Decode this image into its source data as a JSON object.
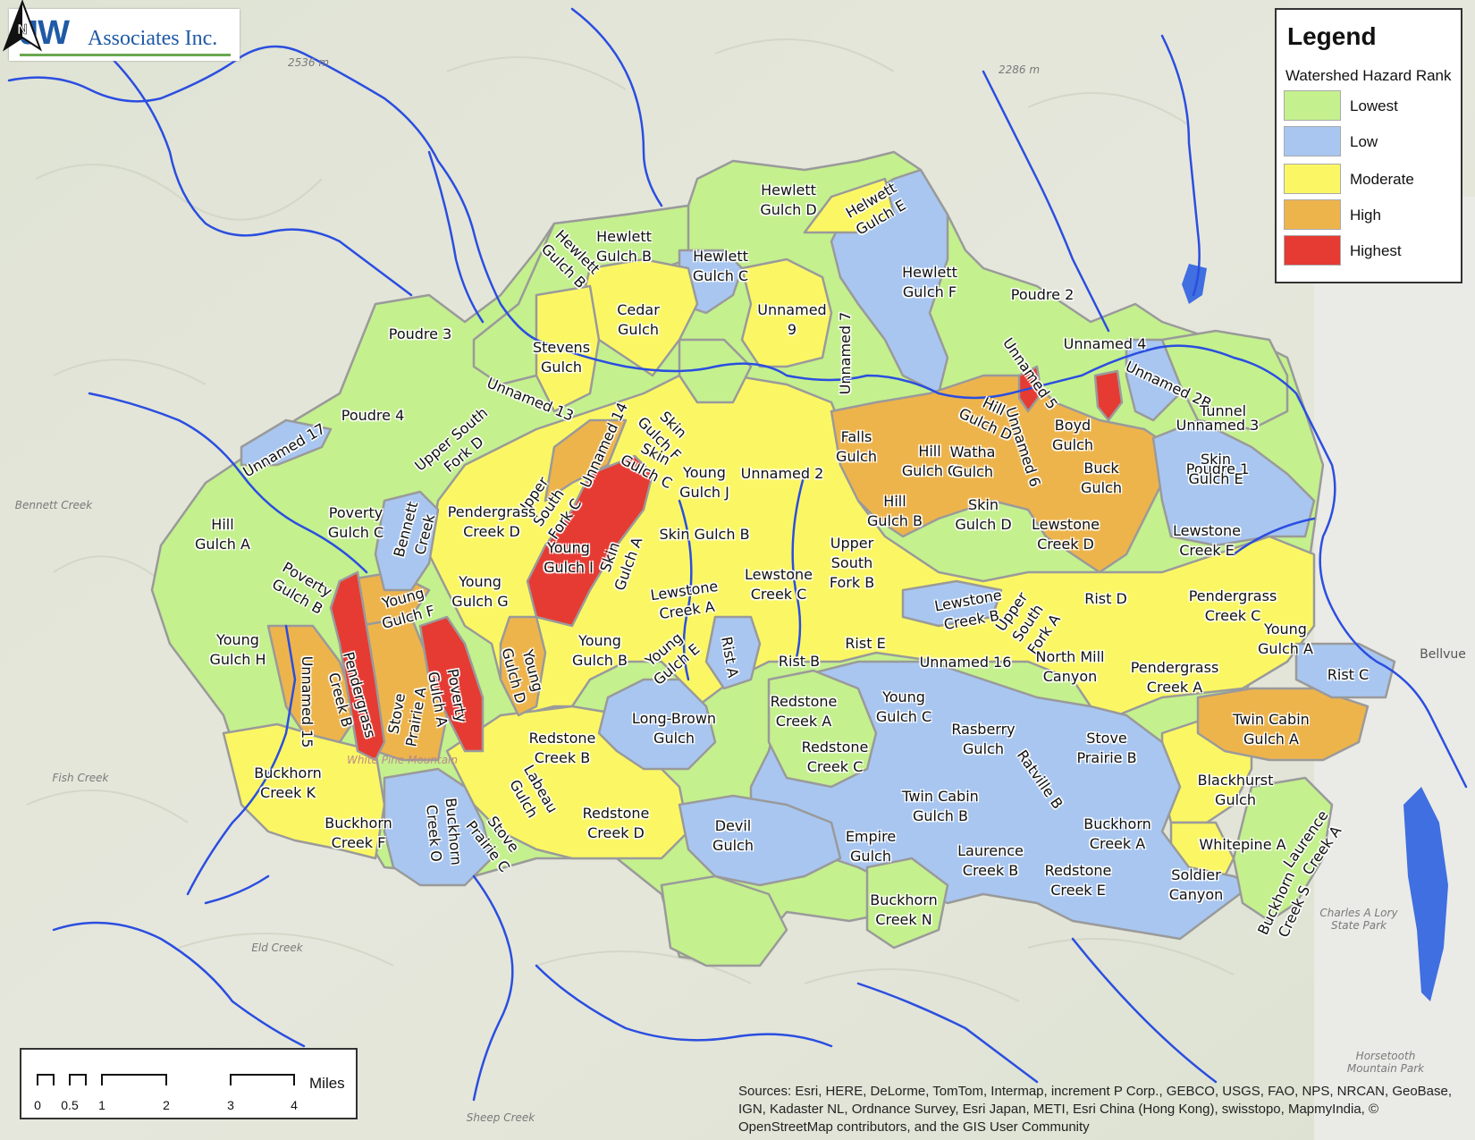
{
  "logo": {
    "brand": "JW",
    "company": "Associates Inc."
  },
  "legend": {
    "title": "Legend",
    "subtitle": "Watershed Hazard Rank",
    "classes": [
      {
        "label": "Lowest",
        "color": "#c4f08e"
      },
      {
        "label": "Low",
        "color": "#a8c6f0"
      },
      {
        "label": "Moderate",
        "color": "#fbf764"
      },
      {
        "label": "High",
        "color": "#eeb44c"
      },
      {
        "label": "Highest",
        "color": "#e53b33"
      }
    ]
  },
  "north_arrow": {
    "label": "N"
  },
  "scalebar": {
    "unit": "Miles",
    "ticks": [
      "0",
      "0.5",
      "1",
      "2",
      "3",
      "4"
    ]
  },
  "credits": "Sources: Esri, HERE, DeLorme, TomTom, Intermap, increment P Corp., GEBCO, USGS, FAO, NPS, NRCAN, GeoBase, IGN, Kadaster NL, Ordnance Survey, Esri Japan, METI, Esri China (Hong Kong), swisstopo, MapmyIndia, © OpenStreetMap contributors, and the GIS User Community",
  "basemap_labels": [
    "2536 m",
    "2286 m",
    "Bellvue",
    "Charles A Lory State Park",
    "Horsetooth Mountain Park",
    "White Pine Mountain",
    "Sheep Creek",
    "Eld Creek",
    "Fish Creek",
    "Bennett Creek"
  ],
  "watersheds": [
    {
      "name": "Hewlett\nGulch D",
      "rank": "Lowest"
    },
    {
      "name": "Helwett\nGulch E",
      "rank": "Moderate"
    },
    {
      "name": "Hewlett\nGulch B",
      "rank": "Lowest"
    },
    {
      "name": "Hewlett\nGulch B",
      "rank": "Lowest"
    },
    {
      "name": "Hewlett\nGulch C",
      "rank": "Low"
    },
    {
      "name": "Hewlett\nGulch F",
      "rank": "Low"
    },
    {
      "name": "Cedar\nGulch",
      "rank": "Moderate"
    },
    {
      "name": "Unnamed\n9",
      "rank": "Moderate"
    },
    {
      "name": "Poudre 2",
      "rank": "Lowest"
    },
    {
      "name": "Poudre 3",
      "rank": "Lowest"
    },
    {
      "name": "Stevens\nGulch",
      "rank": "Moderate"
    },
    {
      "name": "Unnamed 7",
      "rank": "Moderate"
    },
    {
      "name": "Unnamed 4",
      "rank": "Lowest"
    },
    {
      "name": "Unnamed 13",
      "rank": "Lowest"
    },
    {
      "name": "Unnamed 5",
      "rank": "Highest"
    },
    {
      "name": "Unnamed 2B",
      "rank": "Highest"
    },
    {
      "name": "Tunnel",
      "rank": "Lowest"
    },
    {
      "name": "Poudre 4",
      "rank": "Lowest"
    },
    {
      "name": "Unnamed 14",
      "rank": "High"
    },
    {
      "name": "Skin\nGulch F",
      "rank": "Moderate"
    },
    {
      "name": "Hill\nGulch D",
      "rank": "High"
    },
    {
      "name": "Unnamed 6",
      "rank": "High"
    },
    {
      "name": "Boyd\nGulch",
      "rank": "High"
    },
    {
      "name": "Unnamed 3",
      "rank": "Low"
    },
    {
      "name": "Unnamed 17",
      "rank": "Low"
    },
    {
      "name": "Upper South\nFork D",
      "rank": "Lowest"
    },
    {
      "name": "Skin\nGulch C",
      "rank": "Moderate"
    },
    {
      "name": "Falls\nGulch",
      "rank": "High"
    },
    {
      "name": "Hill\nGulch C",
      "rank": "High"
    },
    {
      "name": "Watha\nGulch",
      "rank": "High"
    },
    {
      "name": "Poudre 1",
      "rank": "Low"
    },
    {
      "name": "Skin\nGulch E",
      "rank": "Moderate"
    },
    {
      "name": "Young\nGulch J",
      "rank": "Moderate"
    },
    {
      "name": "Unnamed 2",
      "rank": "High"
    },
    {
      "name": "Buck\nGulch",
      "rank": "High"
    },
    {
      "name": "Upper\nSouth\nFork C",
      "rank": "Lowest"
    },
    {
      "name": "Poverty\nGulch C",
      "rank": "Moderate"
    },
    {
      "name": "Pendergrass\nCreek D",
      "rank": "Low"
    },
    {
      "name": "Bennett\nCreek",
      "rank": "Lowest"
    },
    {
      "name": "Hill\nGulch A",
      "rank": "High"
    },
    {
      "name": "Hill\nGulch B",
      "rank": "Moderate"
    },
    {
      "name": "Skin\nGulch D",
      "rank": "Moderate"
    },
    {
      "name": "Skin Gulch B",
      "rank": "Moderate"
    },
    {
      "name": "Lewstone\nCreek D",
      "rank": "High"
    },
    {
      "name": "Lewstone\nCreek E",
      "rank": "Moderate"
    },
    {
      "name": "Skin\nGulch A",
      "rank": "Highest"
    },
    {
      "name": "Young\nGulch I",
      "rank": "Moderate"
    },
    {
      "name": "Upper\nSouth\nFork B",
      "rank": "Lowest"
    },
    {
      "name": "Poverty\nGulch B",
      "rank": "Moderate"
    },
    {
      "name": "Young\nGulch G",
      "rank": "Moderate"
    },
    {
      "name": "Lewstone\nCreek C",
      "rank": "Moderate"
    },
    {
      "name": "Rist D",
      "rank": "Moderate"
    },
    {
      "name": "Pendergrass\nCreek C",
      "rank": "High"
    },
    {
      "name": "Young\nGulch F",
      "rank": "Moderate"
    },
    {
      "name": "Lewstone\nCreek A",
      "rank": "Low"
    },
    {
      "name": "Lewstone\nCreek B",
      "rank": "Moderate"
    },
    {
      "name": "Upper\nSouth\nFork A",
      "rank": "Lowest"
    },
    {
      "name": "Young\nGulch H",
      "rank": "Moderate"
    },
    {
      "name": "Rist E",
      "rank": "Moderate"
    },
    {
      "name": "Young\nGulch A",
      "rank": "Moderate"
    },
    {
      "name": "Young\nGulch B",
      "rank": "Moderate"
    },
    {
      "name": "Young\nGulch E",
      "rank": "Low"
    },
    {
      "name": "Rist A",
      "rank": "Moderate"
    },
    {
      "name": "Unnamed 16",
      "rank": "High"
    },
    {
      "name": "Unnamed 15",
      "rank": "Highest"
    },
    {
      "name": "Pendergrass\nCreek B",
      "rank": "Highest"
    },
    {
      "name": "Poverty\nGulch A",
      "rank": "High"
    },
    {
      "name": "Young\nGulch D",
      "rank": "Moderate"
    },
    {
      "name": "Rist B",
      "rank": "Moderate"
    },
    {
      "name": "North Mill\nCanyon",
      "rank": "Low"
    },
    {
      "name": "Rist C",
      "rank": "Moderate"
    },
    {
      "name": "Pendergrass\nCreek A",
      "rank": "High"
    },
    {
      "name": "Stove\nPrairie A",
      "rank": "Lowest"
    },
    {
      "name": "Redstone\nCreek A",
      "rank": "Low"
    },
    {
      "name": "Young\nGulch C",
      "rank": "Low"
    },
    {
      "name": "Long-Brown\nGulch",
      "rank": "High"
    },
    {
      "name": "Twin Cabin\nGulch A",
      "rank": "Moderate"
    },
    {
      "name": "Redstone\nCreek B",
      "rank": "Low"
    },
    {
      "name": "Rasberry\nGulch",
      "rank": "Low"
    },
    {
      "name": "Stove\nPrairie B",
      "rank": "Lowest"
    },
    {
      "name": "Redstone\nCreek C",
      "rank": "Low"
    },
    {
      "name": "Ratville B",
      "rank": "Moderate"
    },
    {
      "name": "Buckhorn\nCreek K",
      "rank": "Moderate"
    },
    {
      "name": "Labeau\nGulch",
      "rank": "Moderate"
    },
    {
      "name": "Blackhurst\nGulch",
      "rank": "Low"
    },
    {
      "name": "Twin Cabin\nGulch B",
      "rank": "Moderate"
    },
    {
      "name": "Redstone\nCreek D",
      "rank": "Low"
    },
    {
      "name": "Buckhorn\nCreek A",
      "rank": "Moderate"
    },
    {
      "name": "Buckhorn\nCreek F",
      "rank": "Low"
    },
    {
      "name": "Buckhorn\nCreek O",
      "rank": "Low"
    },
    {
      "name": "Devil\nGulch",
      "rank": "Moderate"
    },
    {
      "name": "Whitepine A",
      "rank": "Moderate"
    },
    {
      "name": "Stove\nPrairie C",
      "rank": "Low"
    },
    {
      "name": "Empire\nGulch",
      "rank": "Lowest"
    },
    {
      "name": "Laurence\nCreek A",
      "rank": "Low"
    },
    {
      "name": "Laurence\nCreek B",
      "rank": "Low"
    },
    {
      "name": "Redstone\nCreek E",
      "rank": "Low"
    },
    {
      "name": "Soldier\nCanyon",
      "rank": "Lowest"
    },
    {
      "name": "Buckhorn\nCreek S",
      "rank": "Lowest"
    },
    {
      "name": "Buckhorn\nCreek N",
      "rank": "Lowest"
    }
  ]
}
